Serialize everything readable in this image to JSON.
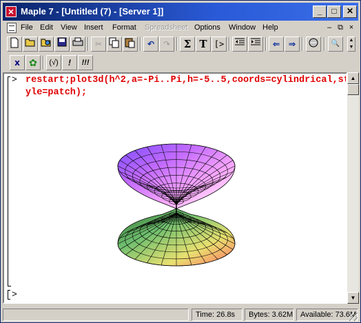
{
  "window": {
    "title": "Maple 7  - [Untitled (7) - [Server 1]]",
    "app_icon": "maple-x-icon",
    "controls": {
      "minimize": "_",
      "maximize": "□",
      "close": "✕"
    }
  },
  "menubar": {
    "items": [
      "File",
      "Edit",
      "View",
      "Insert",
      "Format",
      "Spreadsheet",
      "Options",
      "Window",
      "Help"
    ],
    "disabled": [
      "Spreadsheet"
    ],
    "mdi": {
      "minimize": "–",
      "restore": "⧉",
      "close": "×"
    }
  },
  "toolbar1": {
    "icons": [
      "new-icon",
      "open-icon",
      "open-url-icon",
      "save-icon",
      "print-icon",
      "cut-icon",
      "copy-icon",
      "paste-icon",
      "undo-icon",
      "redo-icon",
      "sum-icon",
      "text-icon",
      "input-icon",
      "outdent-icon",
      "indent-icon",
      "back-icon",
      "forward-icon",
      "stop-icon",
      "zoom-icon"
    ],
    "glyphs": {
      "sum": "Σ",
      "text": "T",
      "input": "[>"
    }
  },
  "toolbar2": {
    "glyphs": {
      "interrupt": "x",
      "restart": "✿",
      "execute": "(√)",
      "bang": "!",
      "bangs": "!!!"
    }
  },
  "worksheet": {
    "prompt": "[>",
    "command": "restart;plot3d(h^2,a=-Pi..Pi,h=-5..5,coords=cylindrical,style=patch);",
    "empty_prompt": "[>"
  },
  "plot": {
    "description_icon": "3d-plot-icon",
    "colors": {
      "top": [
        "#8a5cff",
        "#c46bff",
        "#f0a0ff",
        "#ffffff"
      ],
      "bottom": [
        "#2d6b2d",
        "#7bcc7b",
        "#f0e060",
        "#ff8060"
      ],
      "lines": "#000000"
    }
  },
  "status": {
    "time": "Time:  26.8s",
    "bytes": "Bytes: 3.62M",
    "available": "Available: 73.6M"
  }
}
